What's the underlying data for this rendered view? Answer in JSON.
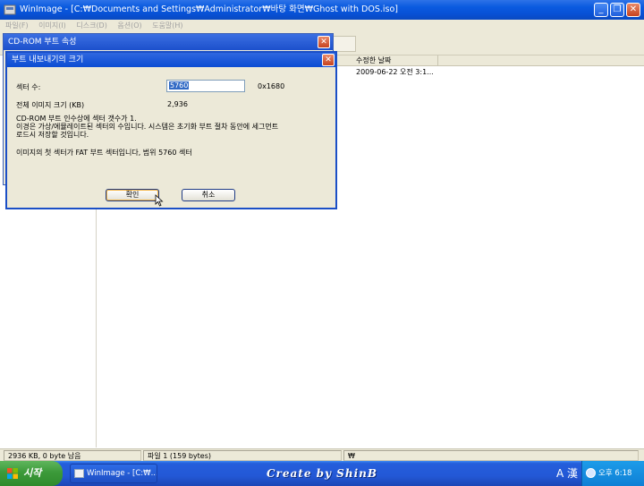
{
  "window": {
    "title": "WinImage - [C:₩Documents and Settings₩Administrator₩바탕 화면₩Ghost with DOS.iso]",
    "minimize_glyph": "_",
    "restore_glyph": "❐",
    "close_glyph": "✕"
  },
  "menu": {
    "items": [
      "파일(F)",
      "이미지(I)",
      "디스크(D)",
      "옵션(O)",
      "도움말(H)"
    ]
  },
  "file_list": {
    "column_modified": "수정한 날짜",
    "row_modified": "2009-06-22  오전 3:1..."
  },
  "status": {
    "left": "2936 KB, 0 byte 남음",
    "middle": "파일 1 (159 bytes)",
    "right": "₩"
  },
  "dialog_back": {
    "title": "CD-ROM 부트 속성",
    "close_glyph": "✕"
  },
  "dialog": {
    "title": "부트 내보내기의 크기",
    "close_glyph": "✕",
    "sector_label": "섹터 수:",
    "sector_value": "5760",
    "sector_hex": "0x1680",
    "image_size_label": "전체 이미지 크기 (KB)",
    "image_size_value": "2,936",
    "info_line1": "CD-ROM 부트 인수상에 섹터 갯수가 1.",
    "info_line2": "이경은 가상/에뮬레이트된 섹터의 수입니다. 시스템은 초기화 부트 절차 동안에 세그먼트",
    "info_line3": "로드시 저장할 것입니다.",
    "fat_note": "이미지의 첫 섹터가 FAT 부트 섹터입니다, 범위 5760 섹터",
    "ok_label": "확인",
    "cancel_label": "취소"
  },
  "taskbar": {
    "start_label": "시작",
    "task_label": "WinImage - [C:₩...",
    "banner": "Create by ShinB",
    "lang_indicator": "A 漢",
    "clock": "오후 6:18"
  }
}
